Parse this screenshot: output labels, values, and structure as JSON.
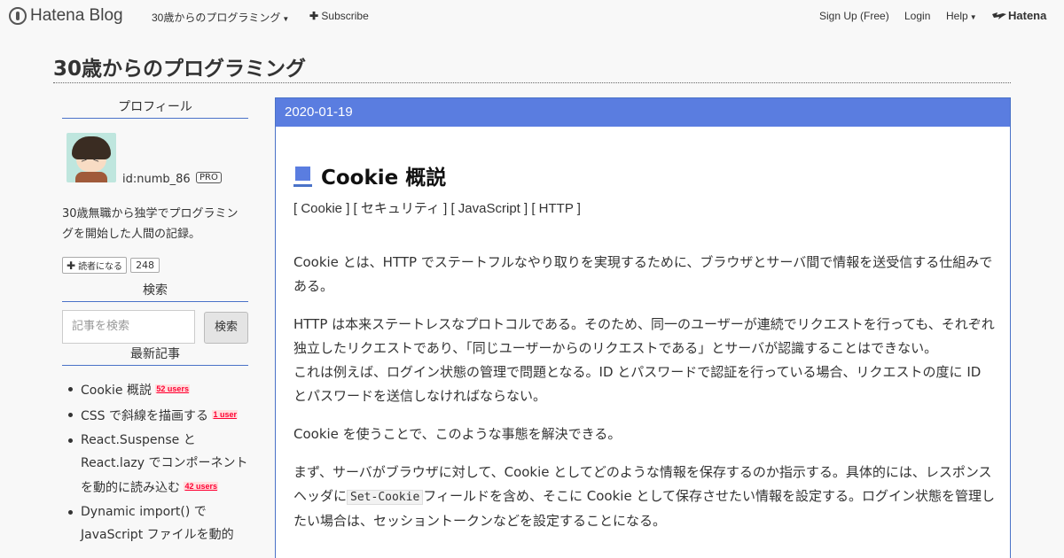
{
  "topbar": {
    "brand": "Hatena Blog",
    "blog_menu": "30歳からのプログラミング",
    "subscribe": "Subscribe",
    "signup": "Sign Up (Free)",
    "login": "Login",
    "help": "Help",
    "hatena": "Hatena"
  },
  "blog": {
    "title": "30歳からのプログラミング"
  },
  "sidebar": {
    "profile_heading": "プロフィール",
    "user_id": "id:numb_86",
    "pro_badge": "PRO",
    "bio": "30歳無職から独学でプログラミングを開始した人間の記録。",
    "reader_button": "読者になる",
    "reader_count": "248",
    "search_heading": "検索",
    "search_placeholder": "記事を検索",
    "search_button": "検索",
    "recent_heading": "最新記事",
    "recent": [
      {
        "title": "Cookie 概説",
        "users": "52 users"
      },
      {
        "title": "CSS で斜線を描画する",
        "users": "1 user"
      },
      {
        "title": "React.Suspense と React.lazy でコンポーネントを動的に読み込む",
        "users": "42 users"
      },
      {
        "title": "Dynamic import() で JavaScript ファイルを動的",
        "users": ""
      }
    ]
  },
  "article": {
    "date": "2020-01-19",
    "title": "Cookie 概説",
    "categories": "[ Cookie ] [ セキュリティ ] [ JavaScript ] [ HTTP ]",
    "p1": "Cookie とは、HTTP でステートフルなやり取りを実現するために、ブラウザとサーバ間で情報を送受信する仕組みである。",
    "p2a": "HTTP は本来ステートレスなプロトコルである。そのため、同一のユーザーが連続でリクエストを行っても、それぞれ独立したリクエストであり、「同じユーザーからのリクエストである」とサーバが認識することはできない。",
    "p2b": "これは例えば、ログイン状態の管理で問題となる。ID とパスワードで認証を行っている場合、リクエストの度に ID とパスワードを送信しなければならない。",
    "p3": "Cookie を使うことで、このような事態を解決できる。",
    "p4_before": "まず、サーバがブラウザに対して、Cookie としてどのような情報を保存するのか指示する。具体的には、レスポンスヘッダに",
    "p4_code": "Set-Cookie",
    "p4_after": "フィールドを含め、そこに Cookie として保存させたい情報を設定する。ログイン状態を管理したい場合は、セッショントークンなどを設定することになる。"
  }
}
